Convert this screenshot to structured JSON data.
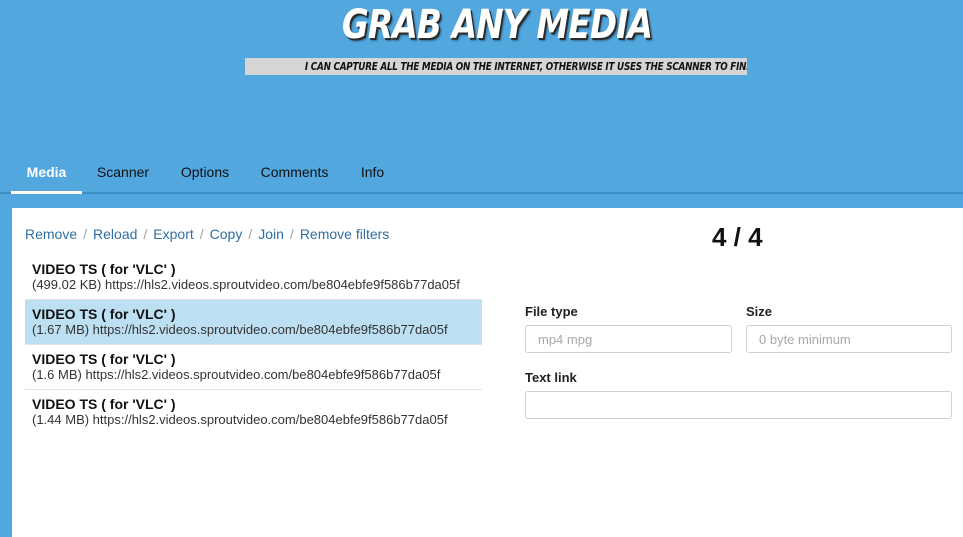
{
  "header": {
    "title": "Grab any Media",
    "subtitle": "I can capture all the media on the internet, otherwise it uses the scanner to find links"
  },
  "tabs": [
    {
      "label": "Media",
      "active": true
    },
    {
      "label": "Scanner",
      "active": false
    },
    {
      "label": "Options",
      "active": false
    },
    {
      "label": "Comments",
      "active": false
    },
    {
      "label": "Info",
      "active": false
    }
  ],
  "actions": [
    "Remove",
    "Reload",
    "Export",
    "Copy",
    "Join",
    "Remove filters"
  ],
  "counter": "4 / 4",
  "media_items": [
    {
      "name": "VIDEO TS ( for 'VLC' )",
      "meta": "(499.02 KB) https://hls2.videos.sproutvideo.com/be804ebfe9f586b77da05f",
      "selected": false
    },
    {
      "name": "VIDEO TS ( for 'VLC' )",
      "meta": "(1.67 MB) https://hls2.videos.sproutvideo.com/be804ebfe9f586b77da05f",
      "selected": true
    },
    {
      "name": "VIDEO TS ( for 'VLC' )",
      "meta": "(1.6 MB) https://hls2.videos.sproutvideo.com/be804ebfe9f586b77da05f",
      "selected": false
    },
    {
      "name": "VIDEO TS ( for 'VLC' )",
      "meta": "(1.44 MB) https://hls2.videos.sproutvideo.com/be804ebfe9f586b77da05f",
      "selected": false
    }
  ],
  "filters": {
    "file_type_label": "File type",
    "file_type_placeholder": "mp4 mpg",
    "file_type_value": "",
    "size_label": "Size",
    "size_placeholder": "0 byte minimum",
    "size_value": "",
    "text_link_label": "Text link",
    "text_link_placeholder": "",
    "text_link_value": ""
  },
  "colors": {
    "background": "#52a7df",
    "panel": "#ffffff",
    "link": "#2f6ea5",
    "selected_row": "#bcdff1"
  }
}
